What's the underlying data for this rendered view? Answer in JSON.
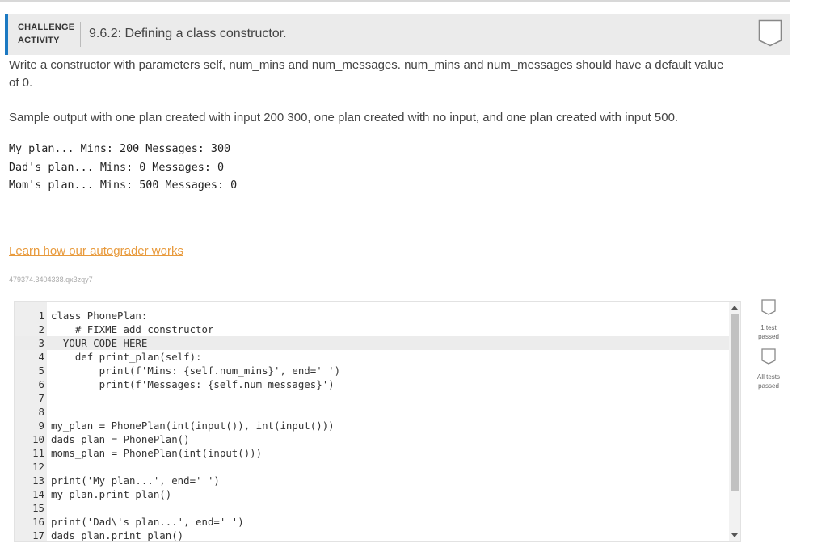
{
  "header": {
    "label_line1": "CHALLENGE",
    "label_line2": "ACTIVITY",
    "title": "9.6.2: Defining a class constructor."
  },
  "instructions": "Write a constructor with parameters self, num_mins and num_messages. num_mins and num_messages should have a default value of 0.",
  "sample_intro": "Sample output with one plan created with input 200 300, one plan created with no input, and one plan created with input 500.",
  "sample_output": [
    "My plan... Mins: 200 Messages: 300",
    "Dad's plan... Mins: 0 Messages: 0",
    "Mom's plan... Mins: 500 Messages: 0"
  ],
  "learn_link": "Learn how our autograder works",
  "activity_id": "479374.3404338.qx3zqy7",
  "editor": {
    "lines": [
      {
        "n": "1",
        "text": "class PhonePlan:"
      },
      {
        "n": "2",
        "text": "    # FIXME add constructor"
      },
      {
        "n": "3",
        "text": "  YOUR CODE HERE"
      },
      {
        "n": "4",
        "text": "    def print_plan(self):"
      },
      {
        "n": "5",
        "text": "        print(f'Mins: {self.num_mins}', end=' ')"
      },
      {
        "n": "6",
        "text": "        print(f'Messages: {self.num_messages}')"
      },
      {
        "n": "7",
        "text": ""
      },
      {
        "n": "8",
        "text": ""
      },
      {
        "n": "9",
        "text": "my_plan = PhonePlan(int(input()), int(input()))"
      },
      {
        "n": "10",
        "text": "dads_plan = PhonePlan()"
      },
      {
        "n": "11",
        "text": "moms_plan = PhonePlan(int(input()))"
      },
      {
        "n": "12",
        "text": ""
      },
      {
        "n": "13",
        "text": "print('My plan...', end=' ')"
      },
      {
        "n": "14",
        "text": "my_plan.print_plan()"
      },
      {
        "n": "15",
        "text": ""
      },
      {
        "n": "16",
        "text": "print('Dad\\'s plan...', end=' ')"
      },
      {
        "n": "17",
        "text": "dads_plan.print_plan()"
      }
    ],
    "active_line": 3
  },
  "tests": [
    {
      "line1": "1 test",
      "line2": "passed"
    },
    {
      "line1": "All tests",
      "line2": "passed"
    }
  ],
  "colors": {
    "accent": "#1c79c2",
    "link": "#e89a3c",
    "header_bg": "#ebebeb"
  }
}
